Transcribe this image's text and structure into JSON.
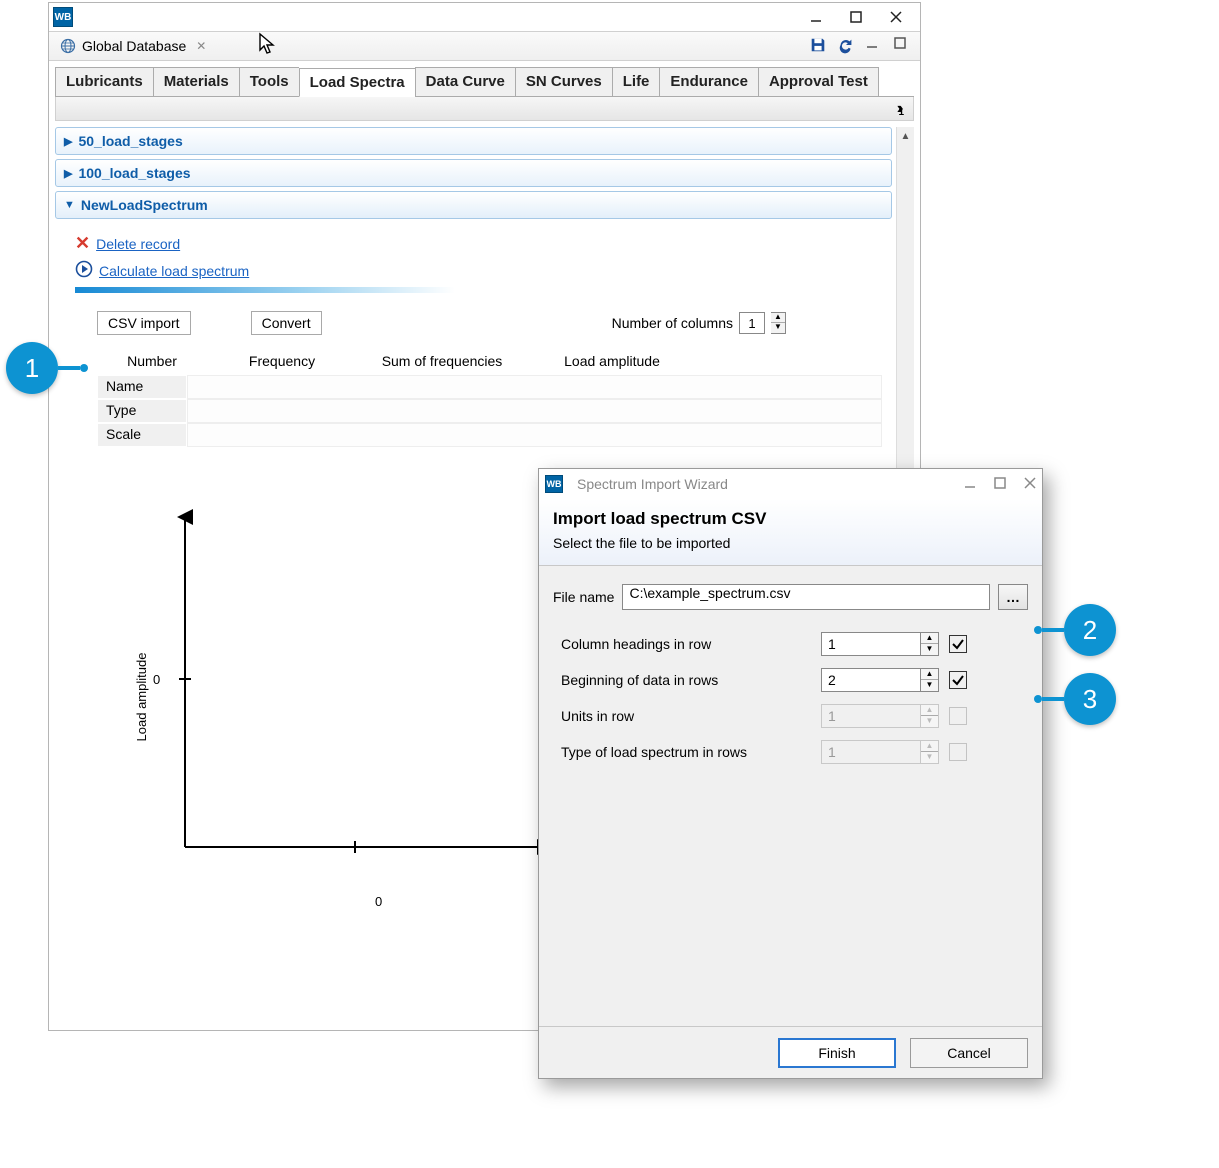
{
  "main": {
    "appIcon": "WB",
    "viewTitle": "Global Database",
    "tabs": [
      "Lubricants",
      "Materials",
      "Tools",
      "Load Spectra",
      "Data Curve",
      "SN Curves",
      "Life",
      "Endurance",
      "Approval Test"
    ],
    "activeTabIndex": 3,
    "subbarMark": "1",
    "accordions": {
      "a1": "50_load_stages",
      "a2": "100_load_stages",
      "a3": "NewLoadSpectrum"
    },
    "links": {
      "delete": "Delete record",
      "calc": "Calculate load spectrum"
    },
    "buttons": {
      "csv": "CSV import",
      "convert": "Convert"
    },
    "numColsLabel": "Number of columns",
    "numColsValue": "1",
    "grid": {
      "headers": {
        "number": "Number",
        "freq": "Frequency",
        "sum": "Sum of frequencies",
        "amp": "Load amplitude"
      },
      "rows": [
        "Name",
        "Type",
        "Scale"
      ]
    },
    "chart": {
      "yLabel": "Load amplitude",
      "yTick0": "0",
      "xTick0": "0"
    }
  },
  "dialog": {
    "appIcon": "WB",
    "title": "Spectrum Import Wizard",
    "heading": "Import load spectrum CSV",
    "subheading": "Select the file to be imported",
    "fileLabel": "File name",
    "fileValue": "C:\\example_spectrum.csv",
    "opts": {
      "colHead": {
        "label": "Column headings in row",
        "value": "1",
        "checked": true,
        "enabled": true
      },
      "dataBeg": {
        "label": "Beginning of data in rows",
        "value": "2",
        "checked": true,
        "enabled": true
      },
      "units": {
        "label": "Units in row",
        "value": "1",
        "checked": false,
        "enabled": false
      },
      "typeRow": {
        "label": "Type of load spectrum in rows",
        "value": "1",
        "checked": false,
        "enabled": false
      }
    },
    "finish": "Finish",
    "cancel": "Cancel"
  },
  "callouts": {
    "c1": "1",
    "c2": "2",
    "c3": "3"
  }
}
